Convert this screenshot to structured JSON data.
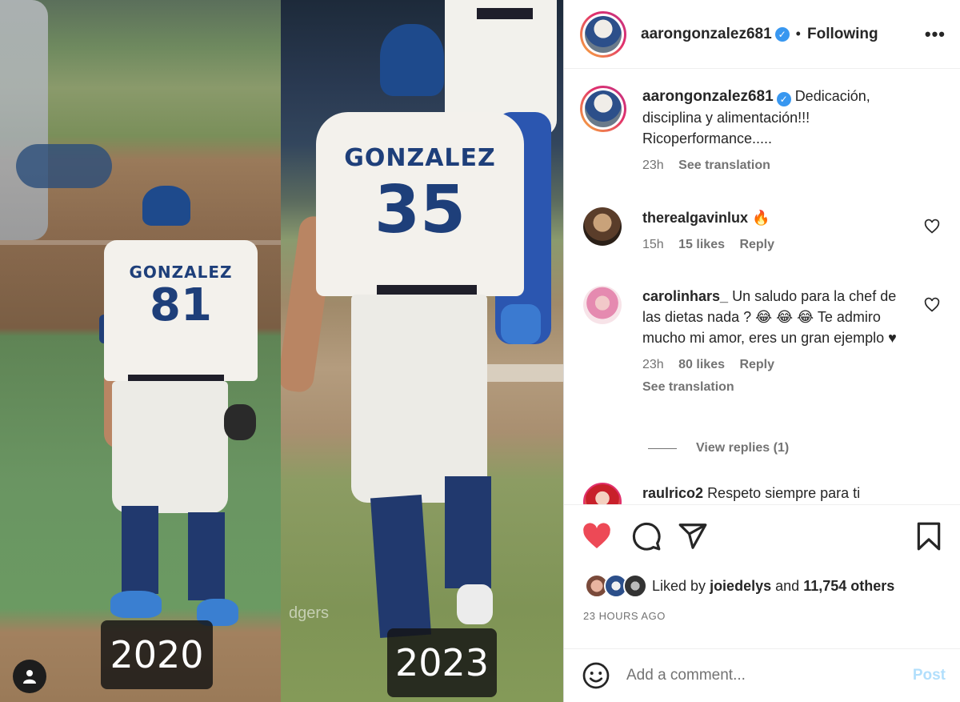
{
  "media": {
    "left_year": "2020",
    "right_year": "2023",
    "left_jersey_name": "GONZALEZ",
    "left_jersey_number": "81",
    "right_jersey_name": "GONZALEZ",
    "right_jersey_number": "35",
    "watermark": "dgers"
  },
  "header": {
    "username": "aarongonzalez681",
    "separator": "•",
    "follow_status": "Following",
    "more_label": "•••"
  },
  "caption": {
    "username": "aarongonzalez681",
    "text": "Dedicación, disciplina y alimentación!!! Ricoperformance.....",
    "time": "23h",
    "see_translation": "See translation"
  },
  "comments": [
    {
      "username": "therealgavinlux",
      "text": "🔥",
      "time": "15h",
      "likes": "15 likes",
      "reply": "Reply"
    },
    {
      "username": "carolinhars_",
      "text": "Un saludo para la chef de las dietas nada ? 😂 😂 😂 Te admiro mucho mi amor, eres un gran ejemplo ♥",
      "time": "23h",
      "likes": "80 likes",
      "reply": "Reply",
      "see_translation": "See translation",
      "view_replies": "View replies (1)"
    },
    {
      "username": "raulrico2",
      "text": "Respeto siempre para ti"
    }
  ],
  "actions": {
    "liked_by_prefix": "Liked by",
    "liked_by_user": "joiedelys",
    "liked_by_and": "and",
    "liked_by_others": "11,754 others",
    "time_ago": "23 HOURS AGO"
  },
  "add_comment": {
    "placeholder": "Add a comment...",
    "post_label": "Post"
  },
  "colors": {
    "like_red": "#ed4956",
    "verified_blue": "#3897f0",
    "post_disabled": "#b2dffc",
    "dodger_blue": "#1e3f7a"
  }
}
